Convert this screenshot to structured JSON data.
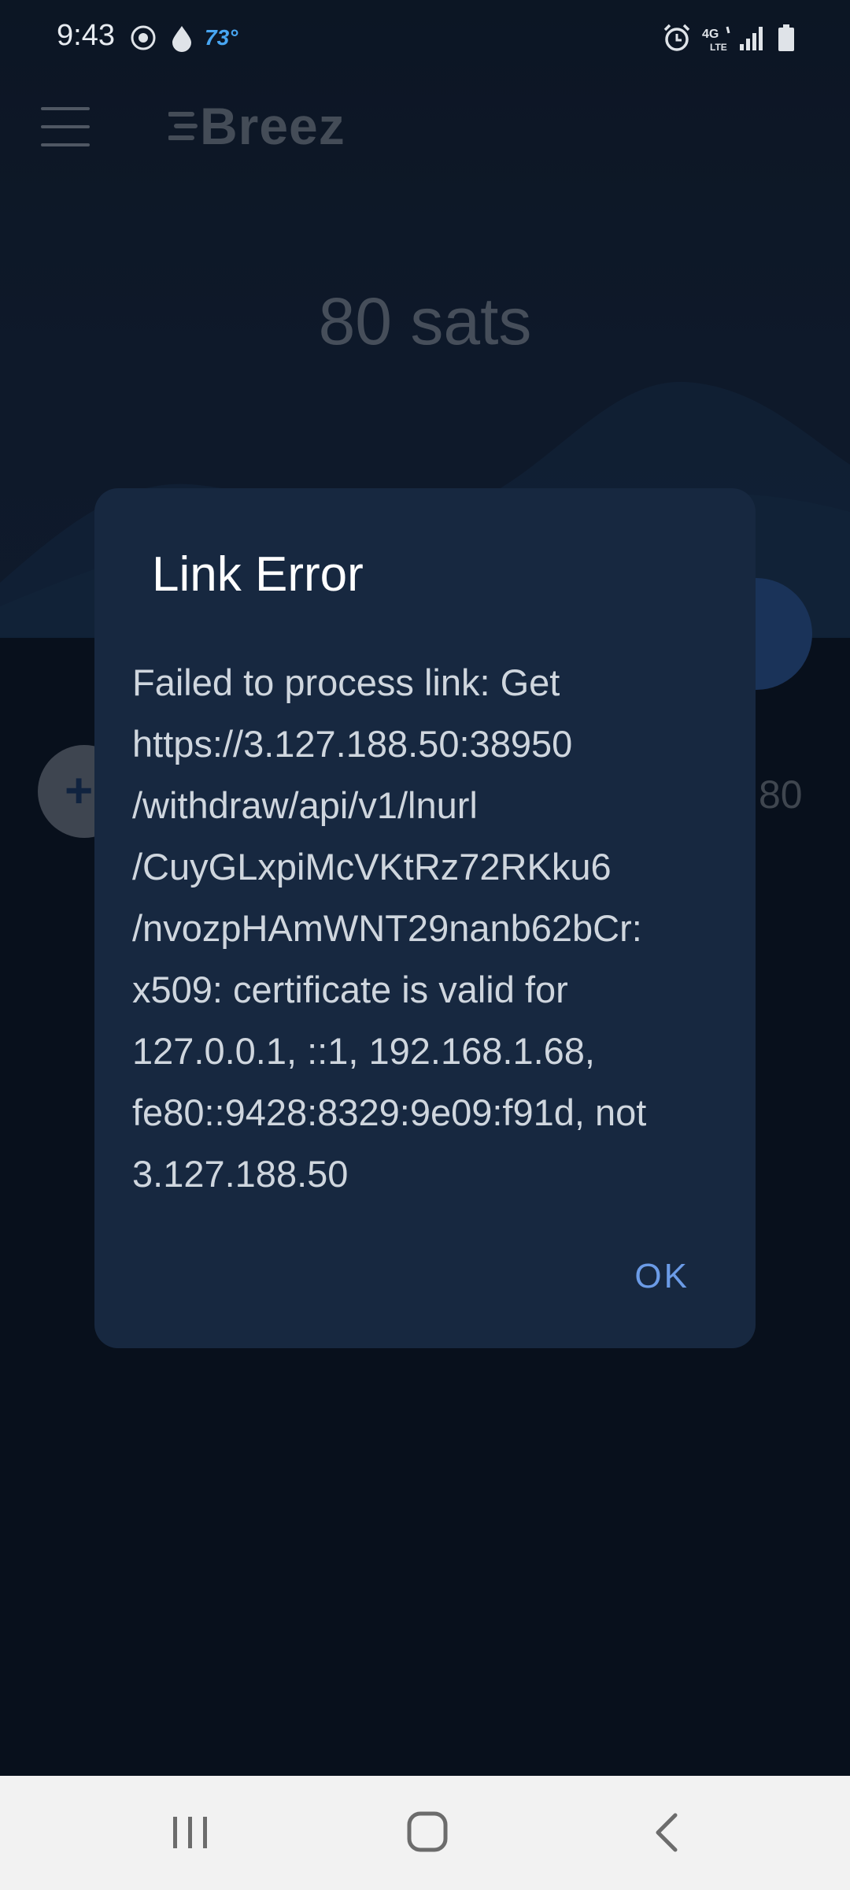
{
  "status_bar": {
    "time": "9:43",
    "temperature": "73°",
    "icons": [
      "weather-icon",
      "drop-icon",
      "alarm-icon",
      "lte-icon",
      "signal-icon",
      "battery-icon"
    ]
  },
  "app_bar": {
    "logo_text": "Breez",
    "menu_icon": "menu-icon"
  },
  "balance": {
    "text": "80 sats"
  },
  "background": {
    "receive_icon": "+",
    "side_amount": "80"
  },
  "dialog": {
    "title": "Link Error",
    "message": "Failed to process link: Get\nhttps://3.127.188.50:38950\n/withdraw/api/v1/lnurl\n/CuyGLxpiMcVKtRz72RKku6\n/nvozpHAmWNT29nanb62bCr:\nx509: certificate is valid for\n127.0.0.1, ::1, 192.168.1.68,\nfe80::9428:8329:9e09:f91d, not\n3.127.188.50",
    "ok_label": "OK"
  },
  "nav_bar": {
    "icons": [
      "recents-icon",
      "home-icon",
      "back-icon"
    ]
  },
  "colors": {
    "dialog_bg": "#172840",
    "accent": "#6b9be6",
    "nav_bg": "#f2f2f2"
  }
}
